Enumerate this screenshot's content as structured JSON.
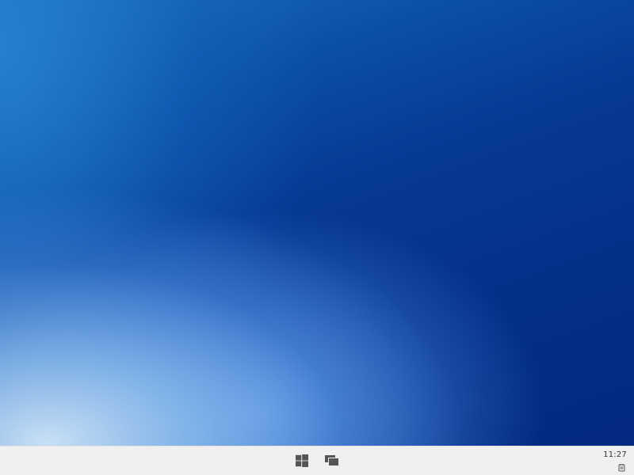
{
  "desktop": {
    "wallpaper": "blue-gradient"
  },
  "taskbar": {
    "background": "#f0f0f0",
    "icon_color": "#555555",
    "start_icon": "windows-logo-icon",
    "task_view_icon": "task-view-icon",
    "clock_time": "11:27",
    "tray_icon": "notification-icon"
  }
}
